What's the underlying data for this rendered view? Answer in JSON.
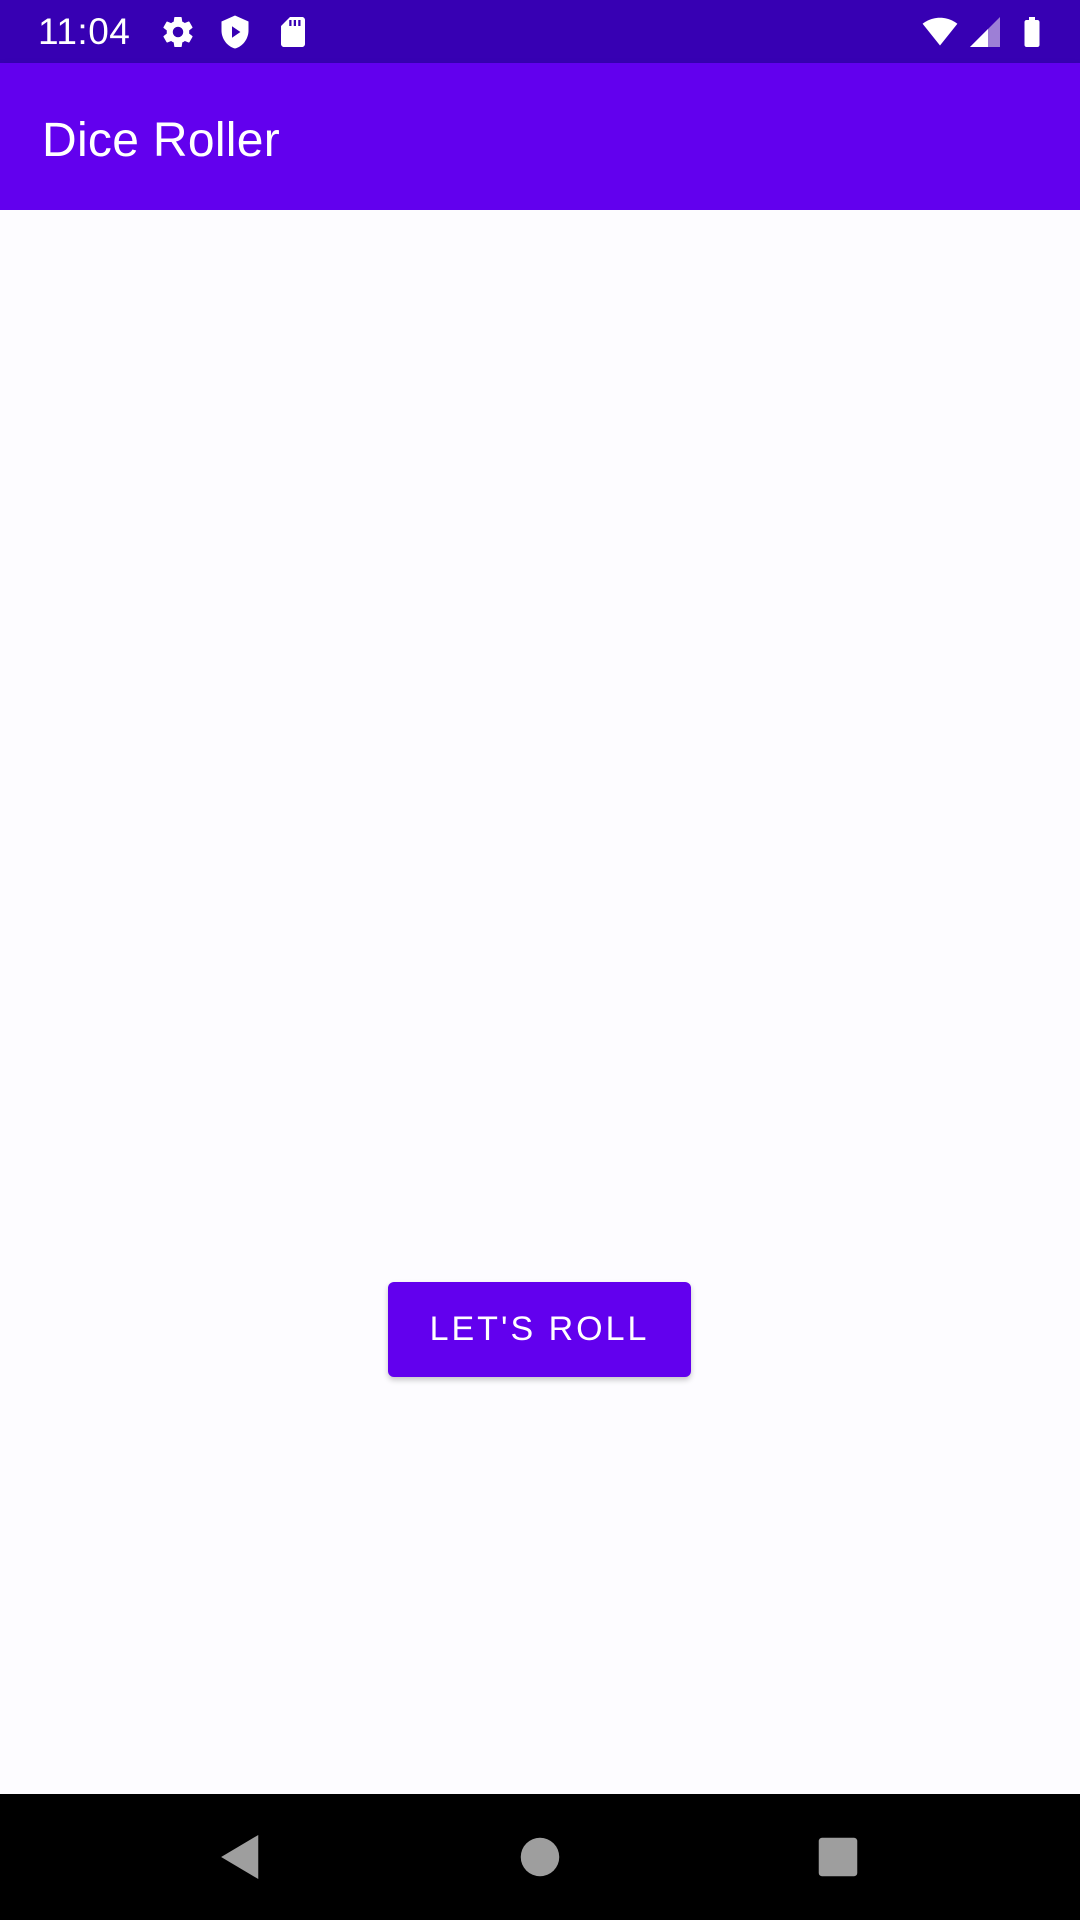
{
  "status_bar": {
    "time": "11:04",
    "left_icons": [
      "gear-icon",
      "shield-icon",
      "sd-card-icon"
    ],
    "right_icons": [
      "wifi-icon",
      "cell-signal-icon",
      "battery-icon"
    ],
    "color": "#3700b3"
  },
  "app_bar": {
    "title": "Dice Roller",
    "color": "#6200ee"
  },
  "main": {
    "roll_button_label": "LET'S ROLL",
    "button_color": "#6200ee"
  },
  "nav_bar": {
    "buttons": [
      "back-icon",
      "home-icon",
      "recents-icon"
    ]
  }
}
